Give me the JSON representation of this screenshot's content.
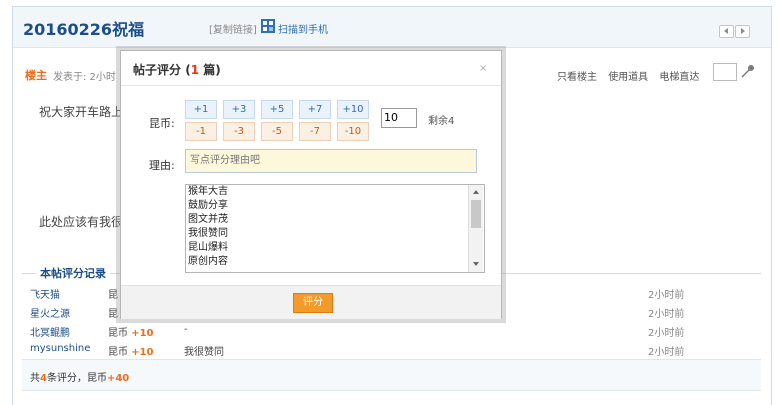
{
  "header": {
    "title": "20160226祝福",
    "copy_link": "[复制链接]",
    "scan_to_phone": "扫描到手机"
  },
  "post_meta": {
    "floor_label": "楼主",
    "posted_at": "发表于: 2小时",
    "only_author": "只看楼主",
    "use_item": "使用道具",
    "jump_floor": "电梯直达"
  },
  "post_body": {
    "line1": "祝大家开车路上",
    "line2": "此处应该有我很"
  },
  "rate_records": {
    "title": "本帖评分记录",
    "rows": [
      {
        "user": "飞天猫",
        "unit": "昆",
        "amount": "",
        "reason": "",
        "time": "2小时前"
      },
      {
        "user": "星火之源",
        "unit": "昆",
        "amount": "",
        "reason": "",
        "time": "2小时前"
      },
      {
        "user": "北冥鲲鹏",
        "unit": "昆币",
        "amount": "+10",
        "reason": "-",
        "time": "2小时前"
      },
      {
        "user": "mysunshine",
        "unit": "昆币",
        "amount": "+10",
        "reason": "我很赞同",
        "time": "2小时前"
      }
    ],
    "total_prefix": "共",
    "total_count": "4",
    "total_mid": "条评分，昆币",
    "total_amount": "+40"
  },
  "modal": {
    "title": "帖子评分",
    "count_open": "(",
    "count": "1",
    "count_unit": " 篇)",
    "close": "×",
    "coin_label": "昆币:",
    "plus_buttons": [
      "+1",
      "+3",
      "+5",
      "+7",
      "+10"
    ],
    "minus_buttons": [
      "-1",
      "-3",
      "-5",
      "-7",
      "-10"
    ],
    "score_value": "10",
    "remaining": "剩余4",
    "reason_label": "理由:",
    "reason_placeholder": "写点评分理由吧",
    "reason_options": [
      "猴年大吉",
      "鼓励分享",
      "图文并茂",
      "我很赞同",
      "昆山爆料",
      "原创内容"
    ],
    "submit": "评分"
  },
  "colors": {
    "accent_blue": "#1d4e89",
    "accent_orange": "#f26c18",
    "submit_orange": "#f49a2a"
  }
}
